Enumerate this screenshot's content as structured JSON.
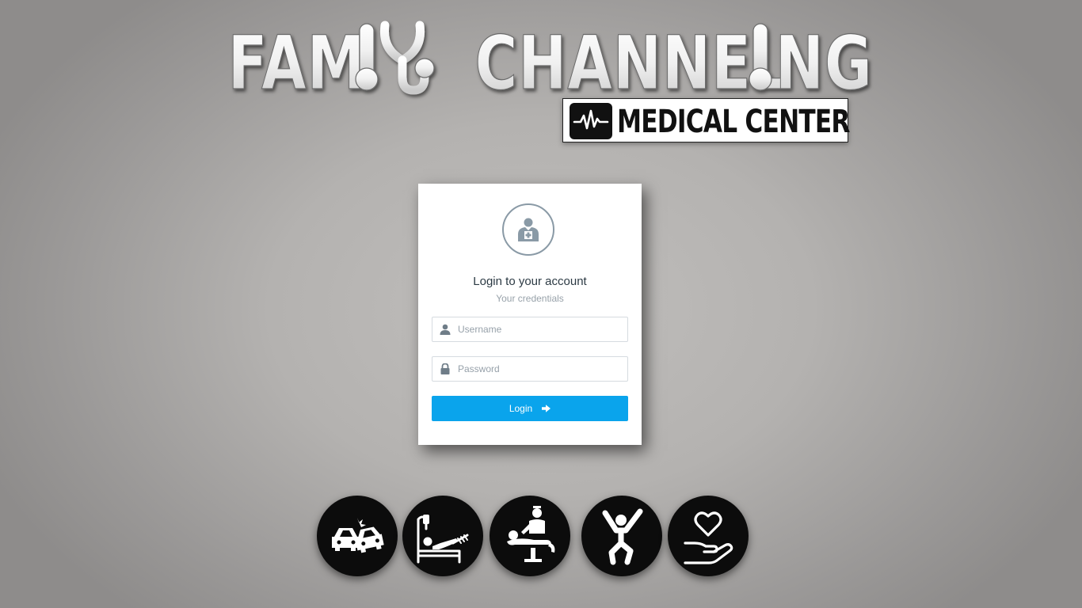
{
  "brand": {
    "title_left": "FAM",
    "title_right": "CHANNEL",
    "title_right_end": "NG",
    "badge_text": "MEDICAL CENTER"
  },
  "login": {
    "title": "Login to your account",
    "subtitle": "Your credentials",
    "username": {
      "value": "",
      "placeholder": "Username",
      "icon": "user-icon"
    },
    "password": {
      "value": "",
      "placeholder": "Password",
      "icon": "lock-icon"
    },
    "button_label": "Login",
    "button_icon": "arrow-right-icon",
    "avatar_icon": "medical-staff-icon"
  },
  "services": [
    {
      "icon": "car-accident-icon"
    },
    {
      "icon": "hospital-bed-patient-icon"
    },
    {
      "icon": "doctor-examining-patient-icon"
    },
    {
      "icon": "jumping-person-icon"
    },
    {
      "icon": "heart-in-hand-icon"
    }
  ],
  "colors": {
    "accent": "#0aa4ec",
    "avatar_border": "#8a9aa6",
    "circle_bg": "#0c0c0c"
  }
}
